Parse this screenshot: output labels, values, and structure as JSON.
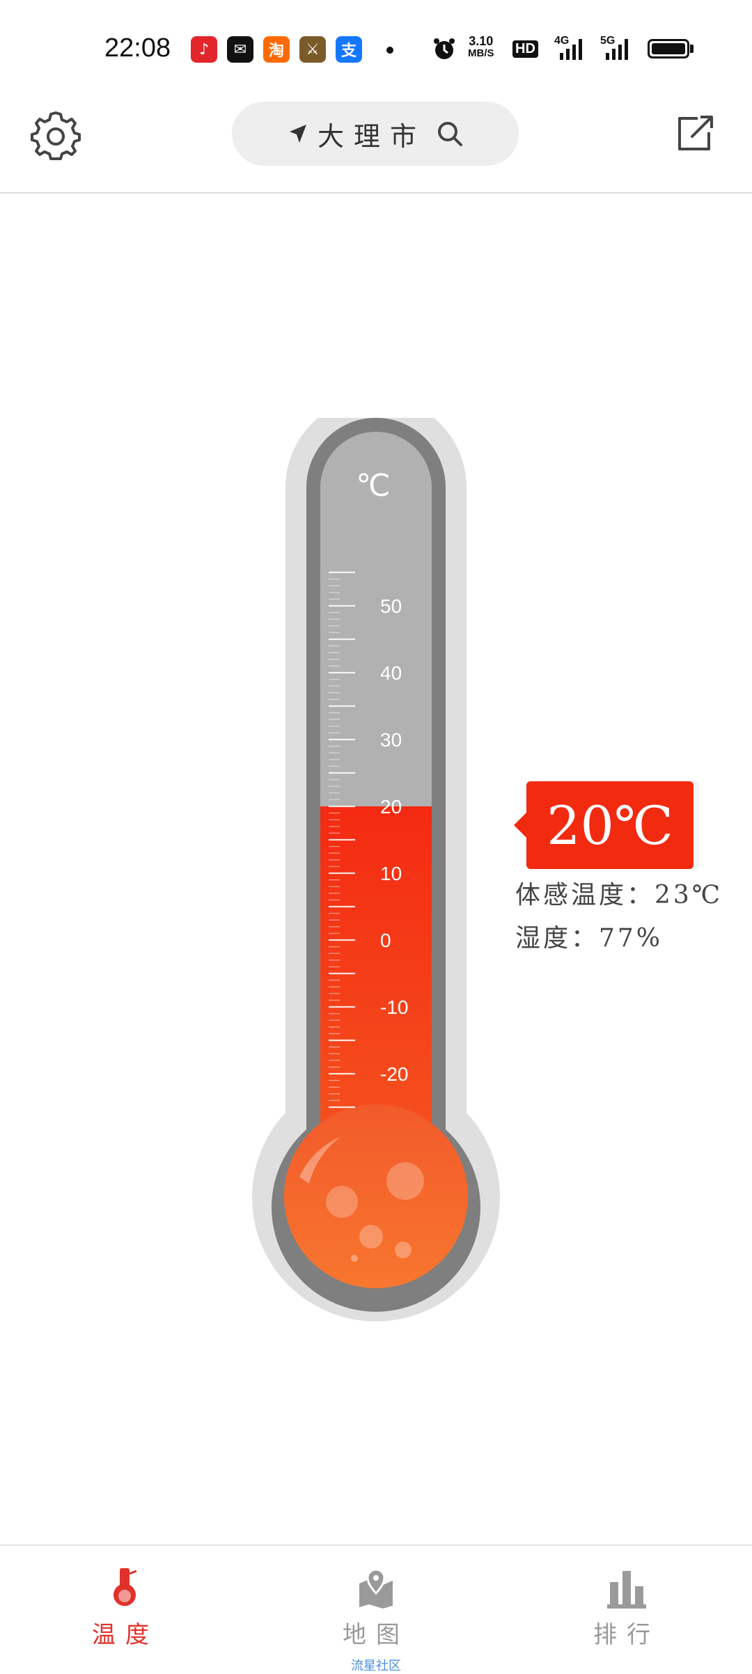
{
  "status_bar": {
    "time": "22:08",
    "net_speed_value": "3.10",
    "net_speed_unit": "MB/S",
    "hd_label": "HD",
    "network_4g": "4G",
    "network_5g": "5G",
    "battery_level": 1.0
  },
  "header": {
    "city": "大理市"
  },
  "thermometer": {
    "unit_symbol": "℃",
    "scale_labels": [
      "50",
      "40",
      "30",
      "20",
      "10",
      "0",
      "-10",
      "-20"
    ],
    "scale_min": -30,
    "scale_max": 55,
    "current_value": 20,
    "fill_color": "#f53a16",
    "empty_color": "#b1b1b1"
  },
  "reading": {
    "temperature": "20℃",
    "feels_like": "体感温度：23℃",
    "humidity": "湿度：77%"
  },
  "nav": {
    "items": [
      {
        "label": "温度",
        "icon": "thermometer-icon",
        "active": true
      },
      {
        "label": "地图",
        "icon": "map-pin-icon",
        "active": false
      },
      {
        "label": "排行",
        "icon": "bar-chart-icon",
        "active": false
      }
    ],
    "sub_caption": "流星社区"
  },
  "colors": {
    "accent": "#e0322b",
    "badge": "#f22a10",
    "inactive": "#999999"
  }
}
